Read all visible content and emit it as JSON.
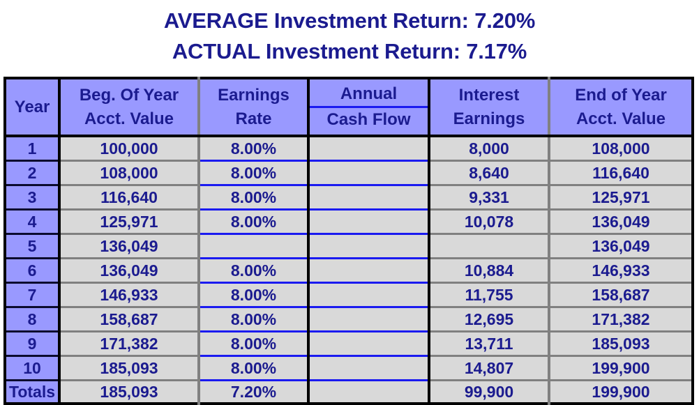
{
  "title": {
    "line1": "AVERAGE Investment Return: 7.20%",
    "line2": "ACTUAL Investment Return: 7.17%",
    "color": "#1b1b8f"
  },
  "colors": {
    "header_bg": "#9999FF",
    "cell_bg": "#D9D9D9",
    "navy_text": "#1B1B8F",
    "green_text": "#128012",
    "blue_rule": "#1A1AF0",
    "gray_rule": "#808080",
    "black_rule": "#000000"
  },
  "table": {
    "headers": [
      {
        "top": "",
        "bottom": "Year"
      },
      {
        "top": "Beg. Of Year",
        "bottom": "Acct. Value"
      },
      {
        "top": "Earnings",
        "bottom": "Rate"
      },
      {
        "top": "Annual",
        "bottom": "Cash Flow",
        "top_underlined": true
      },
      {
        "top": "Interest",
        "bottom": "Earnings"
      },
      {
        "top": "End of Year",
        "bottom": "Acct. Value"
      }
    ],
    "rows": [
      {
        "year": "1",
        "beg": "100,000",
        "rate": "8.00%",
        "cash": "",
        "interest": "8,000",
        "end": "108,000"
      },
      {
        "year": "2",
        "beg": "108,000",
        "rate": "8.00%",
        "cash": "",
        "interest": "8,640",
        "end": "116,640"
      },
      {
        "year": "3",
        "beg": "116,640",
        "rate": "8.00%",
        "cash": "",
        "interest": "9,331",
        "end": "125,971"
      },
      {
        "year": "4",
        "beg": "125,971",
        "rate": "8.00%",
        "cash": "",
        "interest": "10,078",
        "end": "136,049"
      },
      {
        "year": "5",
        "beg": "136,049",
        "rate": "",
        "cash": "",
        "interest": "",
        "end": "136,049"
      },
      {
        "year": "6",
        "beg": "136,049",
        "rate": "8.00%",
        "cash": "",
        "interest": "10,884",
        "end": "146,933"
      },
      {
        "year": "7",
        "beg": "146,933",
        "rate": "8.00%",
        "cash": "",
        "interest": "11,755",
        "end": "158,687"
      },
      {
        "year": "8",
        "beg": "158,687",
        "rate": "8.00%",
        "cash": "",
        "interest": "12,695",
        "end": "171,382"
      },
      {
        "year": "9",
        "beg": "171,382",
        "rate": "8.00%",
        "cash": "",
        "interest": "13,711",
        "end": "185,093"
      },
      {
        "year": "10",
        "beg": "185,093",
        "rate": "8.00%",
        "cash": "",
        "interest": "14,807",
        "end": "199,900"
      }
    ],
    "totals": {
      "year": "Totals",
      "beg": "185,093",
      "rate": "7.20%",
      "cash": "",
      "interest": "99,900",
      "end": "199,900"
    }
  },
  "chart_data": {
    "type": "table",
    "title": "AVERAGE Investment Return: 7.20% / ACTUAL Investment Return: 7.17%",
    "columns": [
      "Year",
      "Beg. Of Year Acct. Value",
      "Earnings Rate",
      "Annual Cash Flow",
      "Interest Earnings",
      "End of Year Acct. Value"
    ],
    "rows": [
      [
        "1",
        100000,
        "8.00%",
        "",
        8000,
        108000
      ],
      [
        "2",
        108000,
        "8.00%",
        "",
        8640,
        116640
      ],
      [
        "3",
        116640,
        "8.00%",
        "",
        9331,
        125971
      ],
      [
        "4",
        125971,
        "8.00%",
        "",
        10078,
        136049
      ],
      [
        "5",
        136049,
        "",
        "",
        "",
        136049
      ],
      [
        "6",
        136049,
        "8.00%",
        "",
        10884,
        146933
      ],
      [
        "7",
        146933,
        "8.00%",
        "",
        11755,
        158687
      ],
      [
        "8",
        158687,
        "8.00%",
        "",
        12695,
        171382
      ],
      [
        "9",
        171382,
        "8.00%",
        "",
        13711,
        185093
      ],
      [
        "10",
        185093,
        "8.00%",
        "",
        14807,
        199900
      ],
      [
        "Totals",
        185093,
        "7.20%",
        "",
        99900,
        199900
      ]
    ],
    "average_return": "7.20%",
    "actual_return": "7.17%"
  }
}
